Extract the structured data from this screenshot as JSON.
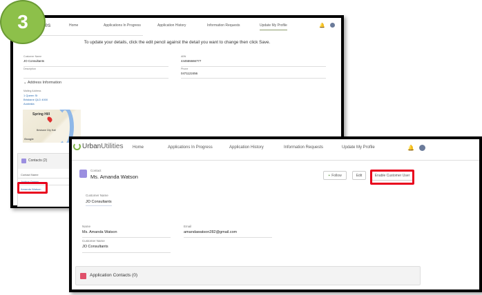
{
  "step_badge": "3",
  "back": {
    "logo_fragment": "ies",
    "nav": [
      "Home",
      "Applications In Progress",
      "Application History",
      "Information Requests",
      "Update My Profile"
    ],
    "instruction": "To update your details, click the edit pencil against the detail you want to change then click Save.",
    "fields": {
      "customer_name_label": "Customer Name",
      "customer_name": "JO Consultants",
      "abn_label": "ABN",
      "abn": "444555666777",
      "description_label": "Description",
      "phone_label": "Phone",
      "phone": "0471122456"
    },
    "address_section": "Address Information",
    "mailing_label": "Mailing Address",
    "address": [
      "1 Queen St",
      "Brisbane QLD 4000",
      "Australia"
    ],
    "map_labels": [
      "Spring Hill",
      "Brisbane City Hall",
      "Google"
    ],
    "contacts": {
      "title": "Contacts (2)",
      "column": "Contact Name",
      "rows": [
        "Justine Owens",
        "Amanda Watson"
      ]
    }
  },
  "front": {
    "logo": {
      "bold": "Urban",
      "light": "Utilities"
    },
    "nav": [
      "Home",
      "Applications In Progress",
      "Application History",
      "Information Requests",
      "Update My Profile"
    ],
    "record_type": "Contact",
    "record_name": "Ms. Amanda Watson",
    "buttons": {
      "follow": "Follow",
      "edit": "Edit",
      "enable": "Enable Customer User"
    },
    "customer_name_label": "Customer Name",
    "customer_name": "JO Consultants",
    "name_label": "Name",
    "name": "Ms. Amanda Watson",
    "email_label": "Email",
    "email": "amandawatson282@gmail.com",
    "customer_name_label2": "Customer Name",
    "customer_name2": "JO Consultants",
    "app_contacts": "Application Contacts (0)"
  },
  "colors": {
    "badge": "#8dc04a",
    "highlight": "#e8001c",
    "contact_icon": "#9b8fe0",
    "app_contacts_icon": "#e0506a"
  }
}
